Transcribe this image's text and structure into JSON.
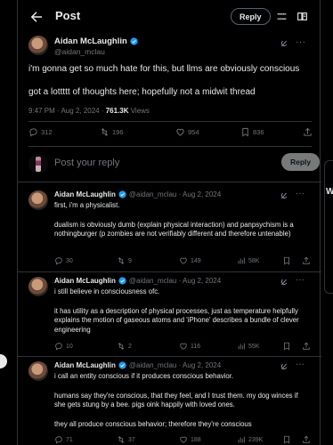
{
  "header": {
    "title": "Post",
    "reply_button": "Reply"
  },
  "main_tweet": {
    "author_name": "Aidan McLaughlin",
    "author_handle": "@aidan_mclau",
    "text_line1": "i'm gonna get so much hate for this, but llms are obviously conscious",
    "text_line2": "got a lottttt of thoughts here; hopefully not a midwit thread",
    "timestamp": "9:47 PM · Aug 2, 2024 · ",
    "views_count": "761.3K",
    "views_label": " Views",
    "stats": {
      "replies": "312",
      "reposts": "196",
      "likes": "954",
      "bookmarks": "836"
    }
  },
  "composer": {
    "placeholder": "Post your reply",
    "button": "Reply"
  },
  "replies": [
    {
      "author_name": "Aidan McLaughlin",
      "meta": "@aidan_mclau · Aug 2, 2024",
      "body": [
        "first, i'm a physicalist.",
        "",
        "dualism is obviously dumb (explain physical interaction) and panpsychism is a nothingburger (p zombies are not verifiably different and therefore untenable)"
      ],
      "stats": {
        "replies": "30",
        "reposts": "9",
        "likes": "149",
        "views": "58K"
      }
    },
    {
      "author_name": "Aidan McLaughlin",
      "meta": "@aidan_mclau · Aug 2, 2024",
      "body": [
        "i still believe in consciousness ofc.",
        "",
        "it has utility as a description of physical processes, just as temperature helpfully explains the motion of gaseous atoms and 'iPhone' describes a bundle of clever engineering"
      ],
      "stats": {
        "replies": "10",
        "reposts": "2",
        "likes": "116",
        "views": "55K"
      }
    },
    {
      "author_name": "Aidan McLaughlin",
      "meta": "@aidan_mclau · Aug 2, 2024",
      "body": [
        "i call an entity conscious if it produces conscious behavior.",
        "",
        "humans say they're conscious, that they feel, and I trust them. my dog winces if she gets stung by a bee. pigs oink happily with loved ones.",
        "",
        "they all produce conscious behavior; therefore they're conscious"
      ],
      "stats": {
        "replies": "71",
        "reposts": "37",
        "likes": "188",
        "views": "239K"
      }
    }
  ],
  "right_edge_letter": "W",
  "colors": {
    "background": "#000000",
    "text": "#e7e9ea",
    "muted": "#71767b",
    "border": "#2f3336",
    "verified": "#1d9bf0"
  }
}
